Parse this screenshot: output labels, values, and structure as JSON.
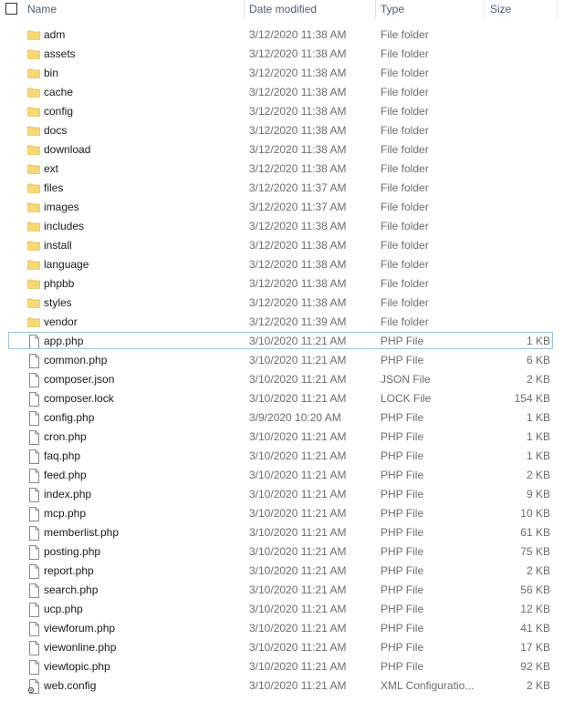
{
  "columns": {
    "name": "Name",
    "date": "Date modified",
    "type": "Type",
    "size": "Size"
  },
  "icons": {
    "folder": "folder-icon",
    "file": "file-icon",
    "config": "config-file-icon"
  },
  "colors": {
    "folder_fill": "#f8d775",
    "folder_tab": "#e8b84a",
    "header_text": "#4c607a",
    "focus_outline": "#99c4e8"
  },
  "rows": [
    {
      "name": "adm",
      "date": "3/12/2020 11:38 AM",
      "type": "File folder",
      "size": "",
      "kind": "folder"
    },
    {
      "name": "assets",
      "date": "3/12/2020 11:38 AM",
      "type": "File folder",
      "size": "",
      "kind": "folder"
    },
    {
      "name": "bin",
      "date": "3/12/2020 11:38 AM",
      "type": "File folder",
      "size": "",
      "kind": "folder"
    },
    {
      "name": "cache",
      "date": "3/12/2020 11:38 AM",
      "type": "File folder",
      "size": "",
      "kind": "folder"
    },
    {
      "name": "config",
      "date": "3/12/2020 11:38 AM",
      "type": "File folder",
      "size": "",
      "kind": "folder"
    },
    {
      "name": "docs",
      "date": "3/12/2020 11:38 AM",
      "type": "File folder",
      "size": "",
      "kind": "folder"
    },
    {
      "name": "download",
      "date": "3/12/2020 11:38 AM",
      "type": "File folder",
      "size": "",
      "kind": "folder"
    },
    {
      "name": "ext",
      "date": "3/12/2020 11:38 AM",
      "type": "File folder",
      "size": "",
      "kind": "folder"
    },
    {
      "name": "files",
      "date": "3/12/2020 11:37 AM",
      "type": "File folder",
      "size": "",
      "kind": "folder"
    },
    {
      "name": "images",
      "date": "3/12/2020 11:37 AM",
      "type": "File folder",
      "size": "",
      "kind": "folder"
    },
    {
      "name": "includes",
      "date": "3/12/2020 11:38 AM",
      "type": "File folder",
      "size": "",
      "kind": "folder"
    },
    {
      "name": "install",
      "date": "3/12/2020 11:38 AM",
      "type": "File folder",
      "size": "",
      "kind": "folder"
    },
    {
      "name": "language",
      "date": "3/12/2020 11:38 AM",
      "type": "File folder",
      "size": "",
      "kind": "folder"
    },
    {
      "name": "phpbb",
      "date": "3/12/2020 11:38 AM",
      "type": "File folder",
      "size": "",
      "kind": "folder"
    },
    {
      "name": "styles",
      "date": "3/12/2020 11:38 AM",
      "type": "File folder",
      "size": "",
      "kind": "folder"
    },
    {
      "name": "vendor",
      "date": "3/12/2020 11:39 AM",
      "type": "File folder",
      "size": "",
      "kind": "folder"
    },
    {
      "name": "app.php",
      "date": "3/10/2020 11:21 AM",
      "type": "PHP File",
      "size": "1 KB",
      "kind": "file",
      "focused": true
    },
    {
      "name": "common.php",
      "date": "3/10/2020 11:21 AM",
      "type": "PHP File",
      "size": "6 KB",
      "kind": "file"
    },
    {
      "name": "composer.json",
      "date": "3/10/2020 11:21 AM",
      "type": "JSON File",
      "size": "2 KB",
      "kind": "file"
    },
    {
      "name": "composer.lock",
      "date": "3/10/2020 11:21 AM",
      "type": "LOCK File",
      "size": "154 KB",
      "kind": "file"
    },
    {
      "name": "config.php",
      "date": "3/9/2020 10:20 AM",
      "type": "PHP File",
      "size": "1 KB",
      "kind": "file"
    },
    {
      "name": "cron.php",
      "date": "3/10/2020 11:21 AM",
      "type": "PHP File",
      "size": "1 KB",
      "kind": "file"
    },
    {
      "name": "faq.php",
      "date": "3/10/2020 11:21 AM",
      "type": "PHP File",
      "size": "1 KB",
      "kind": "file"
    },
    {
      "name": "feed.php",
      "date": "3/10/2020 11:21 AM",
      "type": "PHP File",
      "size": "2 KB",
      "kind": "file"
    },
    {
      "name": "index.php",
      "date": "3/10/2020 11:21 AM",
      "type": "PHP File",
      "size": "9 KB",
      "kind": "file"
    },
    {
      "name": "mcp.php",
      "date": "3/10/2020 11:21 AM",
      "type": "PHP File",
      "size": "10 KB",
      "kind": "file"
    },
    {
      "name": "memberlist.php",
      "date": "3/10/2020 11:21 AM",
      "type": "PHP File",
      "size": "61 KB",
      "kind": "file"
    },
    {
      "name": "posting.php",
      "date": "3/10/2020 11:21 AM",
      "type": "PHP File",
      "size": "75 KB",
      "kind": "file"
    },
    {
      "name": "report.php",
      "date": "3/10/2020 11:21 AM",
      "type": "PHP File",
      "size": "2 KB",
      "kind": "file"
    },
    {
      "name": "search.php",
      "date": "3/10/2020 11:21 AM",
      "type": "PHP File",
      "size": "56 KB",
      "kind": "file"
    },
    {
      "name": "ucp.php",
      "date": "3/10/2020 11:21 AM",
      "type": "PHP File",
      "size": "12 KB",
      "kind": "file"
    },
    {
      "name": "viewforum.php",
      "date": "3/10/2020 11:21 AM",
      "type": "PHP File",
      "size": "41 KB",
      "kind": "file"
    },
    {
      "name": "viewonline.php",
      "date": "3/10/2020 11:21 AM",
      "type": "PHP File",
      "size": "17 KB",
      "kind": "file"
    },
    {
      "name": "viewtopic.php",
      "date": "3/10/2020 11:21 AM",
      "type": "PHP File",
      "size": "92 KB",
      "kind": "file"
    },
    {
      "name": "web.config",
      "date": "3/10/2020 11:21 AM",
      "type": "XML Configuratio...",
      "size": "2 KB",
      "kind": "config"
    }
  ]
}
